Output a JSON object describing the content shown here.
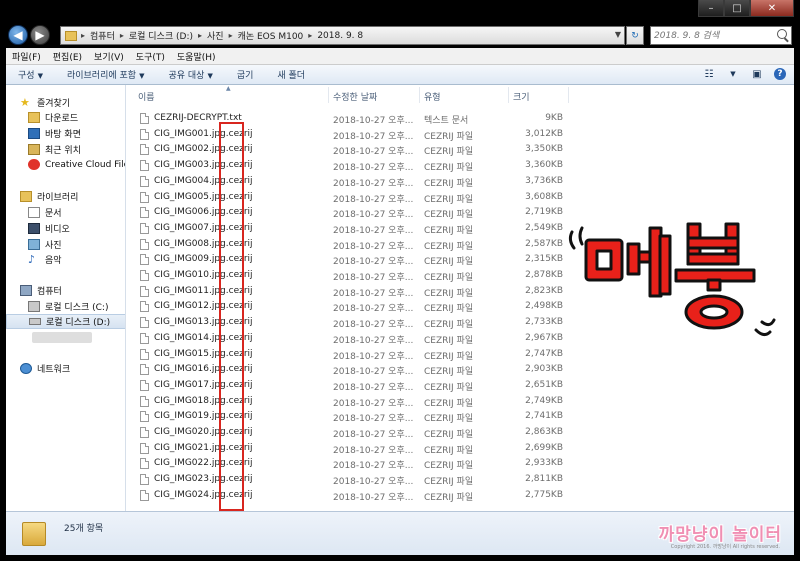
{
  "window": {
    "caption_buttons": [
      "minimize",
      "maximize",
      "close"
    ]
  },
  "address": {
    "breadcrumbs": [
      "컴퓨터",
      "로컬 디스크 (D:)",
      "사진",
      "캐논 EOS M100",
      "2018. 9. 8"
    ],
    "search_placeholder": "2018. 9. 8 검색"
  },
  "menubar": {
    "items": [
      "파일(F)",
      "편집(E)",
      "보기(V)",
      "도구(T)",
      "도움말(H)"
    ]
  },
  "toolbar": {
    "organize": "구성",
    "include_library": "라이브러리에 포함",
    "share": "공유 대상",
    "burn": "굽기",
    "new_folder": "새 폴더"
  },
  "nav": {
    "favorites": "즐겨찾기",
    "downloads": "다운로드",
    "desktop": "바탕 화면",
    "recent": "최근 위치",
    "creative_cloud": "Creative Cloud Files",
    "libraries": "라이브러리",
    "documents": "문서",
    "videos": "비디오",
    "pictures": "사진",
    "music": "음악",
    "computer": "컴퓨터",
    "drive_c": "로컬 디스크 (C:)",
    "drive_d": "로컬 디스크 (D:)",
    "network": "네트워크"
  },
  "columns": {
    "name": "이름",
    "date": "수정한 날짜",
    "type": "유형",
    "size": "크기"
  },
  "files": [
    {
      "name": "CEZRIJ-DECRYPT.txt",
      "date": "2018-10-27 오후...",
      "type": "텍스트 문서",
      "size": "9KB"
    },
    {
      "name": "CIG_IMG001.jpg.cezrij",
      "date": "2018-10-27 오후...",
      "type": "CEZRIJ 파일",
      "size": "3,012KB"
    },
    {
      "name": "CIG_IMG002.jpg.cezrij",
      "date": "2018-10-27 오후...",
      "type": "CEZRIJ 파일",
      "size": "3,350KB"
    },
    {
      "name": "CIG_IMG003.jpg.cezrij",
      "date": "2018-10-27 오후...",
      "type": "CEZRIJ 파일",
      "size": "3,360KB"
    },
    {
      "name": "CIG_IMG004.jpg.cezrij",
      "date": "2018-10-27 오후...",
      "type": "CEZRIJ 파일",
      "size": "3,736KB"
    },
    {
      "name": "CIG_IMG005.jpg.cezrij",
      "date": "2018-10-27 오후...",
      "type": "CEZRIJ 파일",
      "size": "3,608KB"
    },
    {
      "name": "CIG_IMG006.jpg.cezrij",
      "date": "2018-10-27 오후...",
      "type": "CEZRIJ 파일",
      "size": "2,719KB"
    },
    {
      "name": "CIG_IMG007.jpg.cezrij",
      "date": "2018-10-27 오후...",
      "type": "CEZRIJ 파일",
      "size": "2,549KB"
    },
    {
      "name": "CIG_IMG008.jpg.cezrij",
      "date": "2018-10-27 오후...",
      "type": "CEZRIJ 파일",
      "size": "2,587KB"
    },
    {
      "name": "CIG_IMG009.jpg.cezrij",
      "date": "2018-10-27 오후...",
      "type": "CEZRIJ 파일",
      "size": "2,315KB"
    },
    {
      "name": "CIG_IMG010.jpg.cezrij",
      "date": "2018-10-27 오후...",
      "type": "CEZRIJ 파일",
      "size": "2,878KB"
    },
    {
      "name": "CIG_IMG011.jpg.cezrij",
      "date": "2018-10-27 오후...",
      "type": "CEZRIJ 파일",
      "size": "2,823KB"
    },
    {
      "name": "CIG_IMG012.jpg.cezrij",
      "date": "2018-10-27 오후...",
      "type": "CEZRIJ 파일",
      "size": "2,498KB"
    },
    {
      "name": "CIG_IMG013.jpg.cezrij",
      "date": "2018-10-27 오후...",
      "type": "CEZRIJ 파일",
      "size": "2,733KB"
    },
    {
      "name": "CIG_IMG014.jpg.cezrij",
      "date": "2018-10-27 오후...",
      "type": "CEZRIJ 파일",
      "size": "2,967KB"
    },
    {
      "name": "CIG_IMG015.jpg.cezrij",
      "date": "2018-10-27 오후...",
      "type": "CEZRIJ 파일",
      "size": "2,747KB"
    },
    {
      "name": "CIG_IMG016.jpg.cezrij",
      "date": "2018-10-27 오후...",
      "type": "CEZRIJ 파일",
      "size": "2,903KB"
    },
    {
      "name": "CIG_IMG017.jpg.cezrij",
      "date": "2018-10-27 오후...",
      "type": "CEZRIJ 파일",
      "size": "2,651KB"
    },
    {
      "name": "CIG_IMG018.jpg.cezrij",
      "date": "2018-10-27 오후...",
      "type": "CEZRIJ 파일",
      "size": "2,749KB"
    },
    {
      "name": "CIG_IMG019.jpg.cezrij",
      "date": "2018-10-27 오후...",
      "type": "CEZRIJ 파일",
      "size": "2,741KB"
    },
    {
      "name": "CIG_IMG020.jpg.cezrij",
      "date": "2018-10-27 오후...",
      "type": "CEZRIJ 파일",
      "size": "2,863KB"
    },
    {
      "name": "CIG_IMG021.jpg.cezrij",
      "date": "2018-10-27 오후...",
      "type": "CEZRIJ 파일",
      "size": "2,699KB"
    },
    {
      "name": "CIG_IMG022.jpg.cezrij",
      "date": "2018-10-27 오후...",
      "type": "CEZRIJ 파일",
      "size": "2,933KB"
    },
    {
      "name": "CIG_IMG023.jpg.cezrij",
      "date": "2018-10-27 오후...",
      "type": "CEZRIJ 파일",
      "size": "2,811KB"
    },
    {
      "name": "CIG_IMG024.jpg.cezrij",
      "date": "2018-10-27 오후...",
      "type": "CEZRIJ 파일",
      "size": "2,775KB"
    }
  ],
  "status": {
    "item_count": "25개 항목"
  },
  "overlay": {
    "sticker_text": "멘붕",
    "watermark": "까망냥이 놀이터",
    "copyright": "Copyright 2016. 까망냥이 All rights reserved."
  },
  "colors": {
    "highlight_box": "#d8261f",
    "sticker_red": "#e8211a",
    "watermark_pink": "#f08fb3"
  }
}
